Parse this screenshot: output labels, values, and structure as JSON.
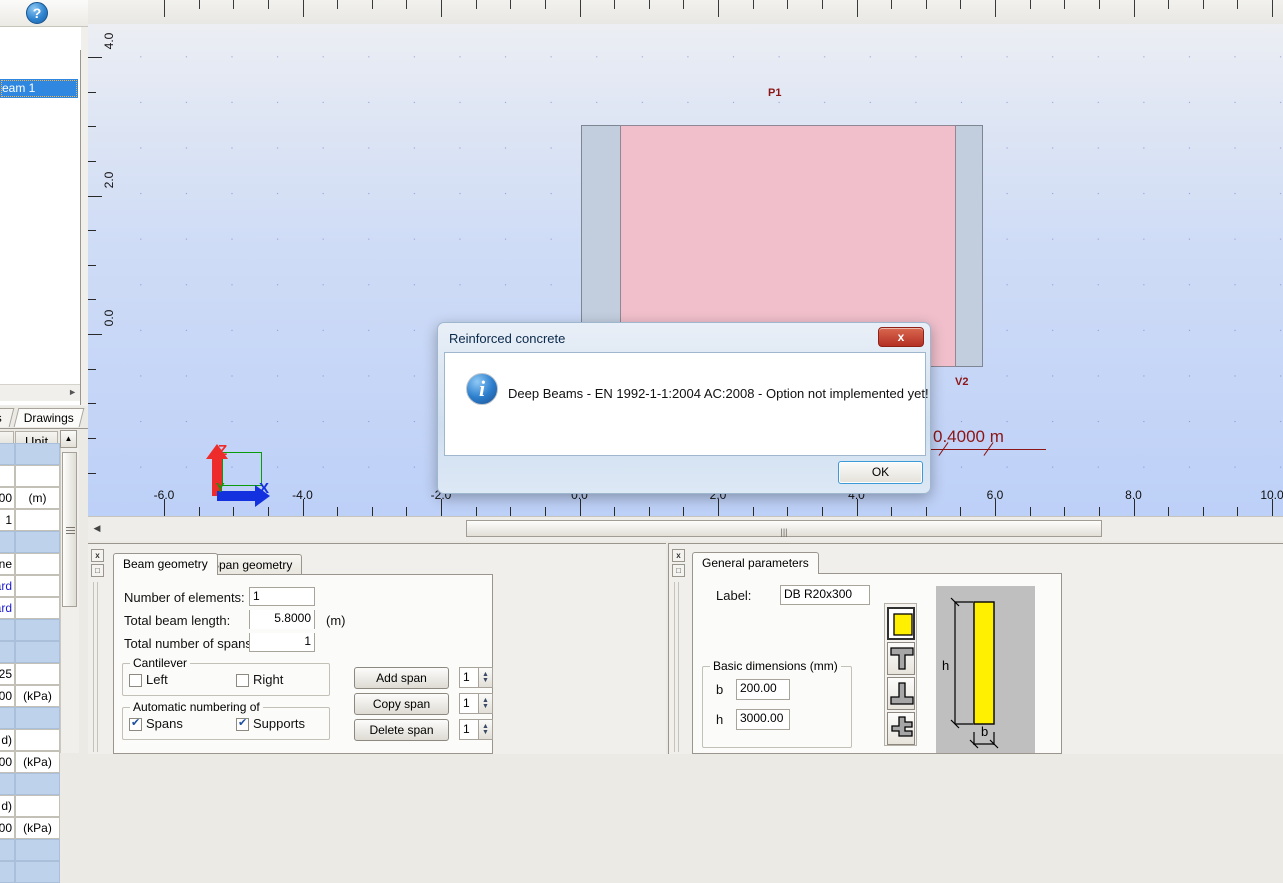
{
  "app": {
    "help_icon": "help-icon",
    "object_item": "eam 1",
    "tabs_left": [
      "s",
      "Drawings"
    ],
    "table_header": [
      "",
      "Unit"
    ]
  },
  "table": {
    "rows": [
      {
        "value": "",
        "unit": "",
        "section": true
      },
      {
        "value": "",
        "unit": "",
        "section": false
      },
      {
        "value": "00",
        "unit": "(m)",
        "section": false
      },
      {
        "value": "1",
        "unit": "",
        "section": false
      },
      {
        "value": "",
        "unit": "",
        "section": true
      },
      {
        "value": "ne",
        "unit": "",
        "section": false
      },
      {
        "value": "ard",
        "unit": "",
        "section": false,
        "blue": true
      },
      {
        "value": "ard",
        "unit": "",
        "section": false,
        "blue": true
      },
      {
        "value": "",
        "unit": "",
        "section": true
      },
      {
        "value": "",
        "unit": "",
        "section": true
      },
      {
        "value": "25",
        "unit": "",
        "section": false
      },
      {
        "value": "00",
        "unit": "(kPa)",
        "section": false
      },
      {
        "value": "",
        "unit": "",
        "section": true
      },
      {
        "value": "d)",
        "unit": "",
        "section": false
      },
      {
        "value": "00",
        "unit": "(kPa)",
        "section": false
      },
      {
        "value": "",
        "unit": "",
        "section": true
      },
      {
        "value": "d)",
        "unit": "",
        "section": false
      },
      {
        "value": "00",
        "unit": "(kPa)",
        "section": false
      },
      {
        "value": "",
        "unit": "",
        "section": true
      },
      {
        "value": "",
        "unit": "",
        "section": true
      }
    ]
  },
  "view": {
    "h_ticks": [
      "-6.0",
      "-4.0",
      "-2.0",
      "0.0",
      "2.0",
      "4.0",
      "6.0",
      "8.0",
      "10.0"
    ],
    "v_ticks": [
      "4.0",
      "2.0",
      "0.0"
    ],
    "label_p1": "P1",
    "label_v2": "V2",
    "dimension": "0.4000 m",
    "axis_z": "Z",
    "axis_x": "X",
    "axis_y": "Y"
  },
  "dialog": {
    "title": "Reinforced concrete",
    "close_label": "x",
    "info_glyph": "i",
    "message": "Deep Beams - EN 1992-1-1:2004 AC:2008 - Option not implemented yet!",
    "ok_label": "OK"
  },
  "beam_panel": {
    "tabs": [
      {
        "label": "Beam geometry",
        "active": true
      },
      {
        "label": "Span geometry",
        "active": false
      }
    ],
    "close_glyph": "x",
    "restore_glyph": "□",
    "fields": {
      "number_of_elements_label": "Number of elements:",
      "number_of_elements_value": "1",
      "total_beam_length_label": "Total beam length:",
      "total_beam_length_value": "5.8000",
      "total_beam_length_unit": "(m)",
      "total_number_of_spans_label": "Total number of spans:",
      "total_number_of_spans_value": "1"
    },
    "cantilever": {
      "legend": "Cantilever",
      "left_label": "Left",
      "left_checked": false,
      "right_label": "Right",
      "right_checked": false
    },
    "numbering": {
      "legend": "Automatic numbering of",
      "spans_label": "Spans",
      "spans_checked": true,
      "supports_label": "Supports",
      "supports_checked": true
    },
    "actions": [
      {
        "label": "Add span",
        "count": "1"
      },
      {
        "label": "Copy span",
        "count": "1"
      },
      {
        "label": "Delete span",
        "count": "1"
      }
    ]
  },
  "general_panel": {
    "tabs": [
      {
        "label": "General parameters",
        "active": true
      }
    ],
    "close_glyph": "x",
    "restore_glyph": "□",
    "label_caption": "Label:",
    "label_value": "DB R20x300",
    "dimensions": {
      "legend": "Basic dimensions (mm)",
      "b_label": "b",
      "b_value": "200.00",
      "h_label": "h",
      "h_value": "3000.00"
    },
    "shapes": [
      {
        "name": "rectangular-section",
        "selected": true
      },
      {
        "name": "t-section",
        "selected": false
      },
      {
        "name": "inverted-t-section",
        "selected": false
      },
      {
        "name": "stepped-section",
        "selected": false
      }
    ],
    "preview": {
      "h_label": "h",
      "b_label": "b"
    }
  }
}
